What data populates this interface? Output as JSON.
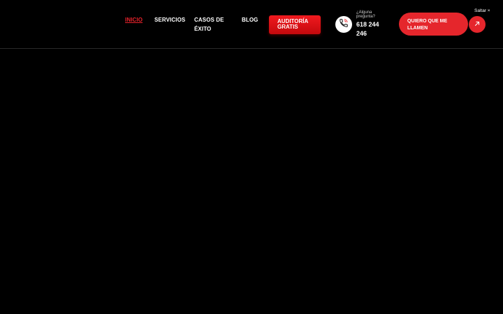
{
  "nav": {
    "items": [
      {
        "label": "INICIO",
        "active": true
      },
      {
        "label": "SERVICIOS"
      },
      {
        "label": "CASOS DE ÉXITO"
      },
      {
        "label": "BLOG"
      }
    ]
  },
  "cta": {
    "audit_label": "AUDITORÍA GRATIS",
    "call_label": "QUIERO QUE ME LLAMEN"
  },
  "contact": {
    "question": "¿Alguna pregunta?",
    "phone": "618 244 246",
    "phone_icon": "phone-icon"
  },
  "skip": {
    "label": "Saltar ×"
  },
  "colors": {
    "accent": "#e5262c",
    "background": "#000000",
    "text": "#ffffff"
  }
}
